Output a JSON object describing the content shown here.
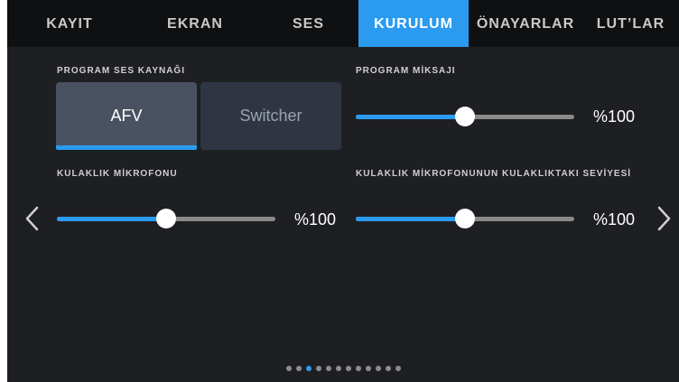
{
  "tabs": [
    {
      "label": "KAYIT",
      "active": false
    },
    {
      "label": "EKRAN",
      "active": false
    },
    {
      "label": "SES",
      "active": false
    },
    {
      "label": "KURULUM",
      "active": true
    },
    {
      "label": "ÖNAYARLAR",
      "active": false
    },
    {
      "label": "LUT’LAR",
      "active": false
    }
  ],
  "program_audio_source": {
    "label": "PROGRAM SES KAYNAĞI",
    "options": [
      "AFV",
      "Switcher"
    ],
    "selected": "AFV"
  },
  "program_mix": {
    "label": "PROGRAM MİKSAJI",
    "level": 0.5,
    "value": "%100"
  },
  "headset_mic": {
    "label": "KULAKLIK MİKROFONU",
    "level": 0.5,
    "value": "%100"
  },
  "headset_mic_in_headphones": {
    "label": "KULAKLIK MİKROFONUNUN KULAKLIKTAKI SEVİYESİ",
    "level": 0.5,
    "value": "%100"
  },
  "pagination": {
    "count": 12,
    "active_index": 2
  },
  "colors": {
    "accent": "#2b9bf0",
    "background": "#1e1f22",
    "tabbar": "#0f1012"
  },
  "icons": {
    "prev": "chevron-left-icon",
    "next": "chevron-right-icon"
  }
}
